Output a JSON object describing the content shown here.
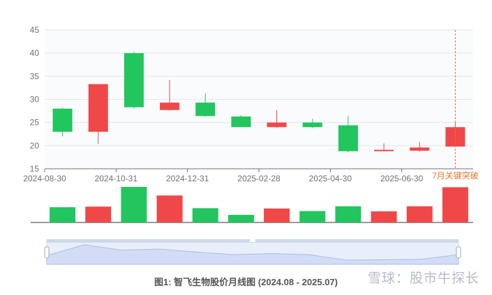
{
  "chart_data": {
    "type": "candlestick",
    "title": "图1: 智飞生物股价月线图 (2024.08 - 2025.07)",
    "ylim": [
      15,
      45
    ],
    "y_ticks": [
      15,
      20,
      25,
      30,
      35,
      40,
      45
    ],
    "x_tick_labels": [
      "2024-08-30",
      "2024-10-31",
      "2024-12-31",
      "2025-02-28",
      "2025-04-30",
      "2025-06-30"
    ],
    "annotation": "7月关键突破",
    "colors": {
      "up": "#f04848",
      "down": "#22c55e",
      "annotation": "#e07a2f"
    },
    "series": [
      {
        "date": "2024-08-30",
        "open": 28.0,
        "close": 23.0,
        "high": 28.2,
        "low": 22.0,
        "volume": 48
      },
      {
        "date": "2024-09-30",
        "open": 23.0,
        "close": 33.3,
        "high": 33.3,
        "low": 20.4,
        "volume": 50
      },
      {
        "date": "2024-10-31",
        "open": 40.0,
        "close": 28.3,
        "high": 40.3,
        "low": 28.0,
        "volume": 112
      },
      {
        "date": "2024-11-29",
        "open": 27.7,
        "close": 29.3,
        "high": 34.2,
        "low": 27.6,
        "volume": 85
      },
      {
        "date": "2024-12-31",
        "open": 29.3,
        "close": 26.4,
        "high": 31.3,
        "low": 26.3,
        "volume": 45
      },
      {
        "date": "2025-01-27",
        "open": 26.3,
        "close": 24.0,
        "high": 26.6,
        "low": 24.0,
        "volume": 24
      },
      {
        "date": "2025-02-28",
        "open": 24.0,
        "close": 25.0,
        "high": 27.7,
        "low": 23.8,
        "volume": 44
      },
      {
        "date": "2025-03-31",
        "open": 25.0,
        "close": 24.0,
        "high": 25.8,
        "low": 23.8,
        "volume": 36
      },
      {
        "date": "2025-04-30",
        "open": 24.4,
        "close": 18.8,
        "high": 26.4,
        "low": 18.6,
        "volume": 51
      },
      {
        "date": "2025-05-30",
        "open": 18.8,
        "close": 19.1,
        "high": 20.5,
        "low": 18.8,
        "volume": 35
      },
      {
        "date": "2025-06-30",
        "open": 18.9,
        "close": 19.6,
        "high": 20.8,
        "low": 18.7,
        "volume": 51
      },
      {
        "date": "2025-07-31",
        "open": 19.8,
        "close": 24.0,
        "high": 25.0,
        "low": 19.7,
        "volume": 111
      }
    ]
  },
  "caption": "图1: 智飞生物股价月线图 (2024.08 - 2025.07)",
  "watermark": "雪球：股市牛探长"
}
